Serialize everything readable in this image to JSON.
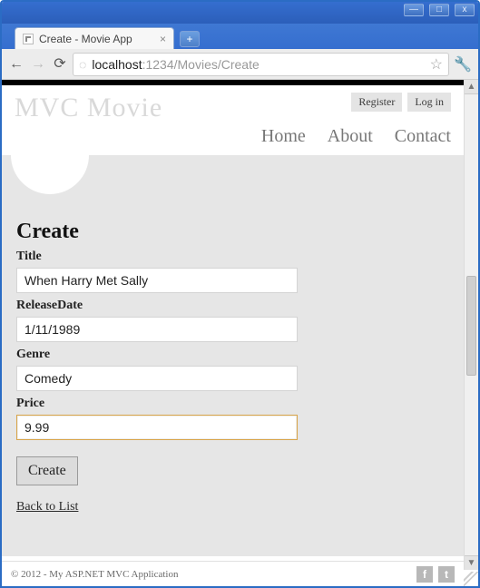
{
  "window": {
    "tab_title": "Create - Movie App",
    "minimize": "—",
    "maximize": "□",
    "close": "x",
    "newtab": "+",
    "tab_close": "×"
  },
  "toolbar": {
    "back": "←",
    "forward": "→",
    "reload": "⟳",
    "globe": "◌",
    "url_host": "localhost",
    "url_path": ":1234/Movies/Create",
    "star": "☆",
    "wrench": "🔧"
  },
  "header": {
    "brand": "MVC Movie",
    "register": "Register",
    "login": "Log in",
    "nav": {
      "home": "Home",
      "about": "About",
      "contact": "Contact"
    }
  },
  "form": {
    "heading": "Create",
    "title_label": "Title",
    "title_value": "When Harry Met Sally",
    "releasedate_label": "ReleaseDate",
    "releasedate_value": "1/11/1989",
    "genre_label": "Genre",
    "genre_value": "Comedy",
    "price_label": "Price",
    "price_value": "9.99",
    "submit_label": "Create",
    "back_label": "Back to List"
  },
  "footer": {
    "text": "© 2012 - My ASP.NET MVC Application",
    "fb": "f",
    "tw": "t"
  },
  "scrollbar": {
    "up": "▲",
    "down": "▼"
  }
}
